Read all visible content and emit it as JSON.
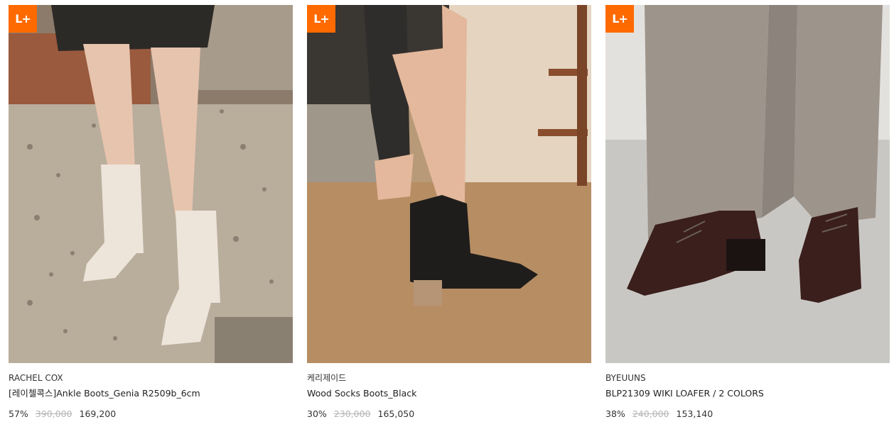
{
  "badge_label": "L+",
  "colors": {
    "badge": "#ff6a00",
    "strike": "#b5b5b5"
  },
  "products": [
    {
      "brand": "RACHEL COX",
      "name": "[레이첼콕스]Ankle Boots_Genia R2509b_6cm",
      "discount": "57%",
      "original_price": "390,000",
      "sale_price": "169,200",
      "image_icon": "white-ankle-boots-photo"
    },
    {
      "brand": "케리제이드",
      "name": "Wood Socks Boots_Black",
      "discount": "30%",
      "original_price": "230,000",
      "sale_price": "165,050",
      "image_icon": "black-socks-boots-photo"
    },
    {
      "brand": "BYEUUNS",
      "name": "BLP21309 WIKI LOAFER / 2 COLORS",
      "discount": "38%",
      "original_price": "240,000",
      "sale_price": "153,140",
      "image_icon": "brown-loafer-photo"
    }
  ]
}
